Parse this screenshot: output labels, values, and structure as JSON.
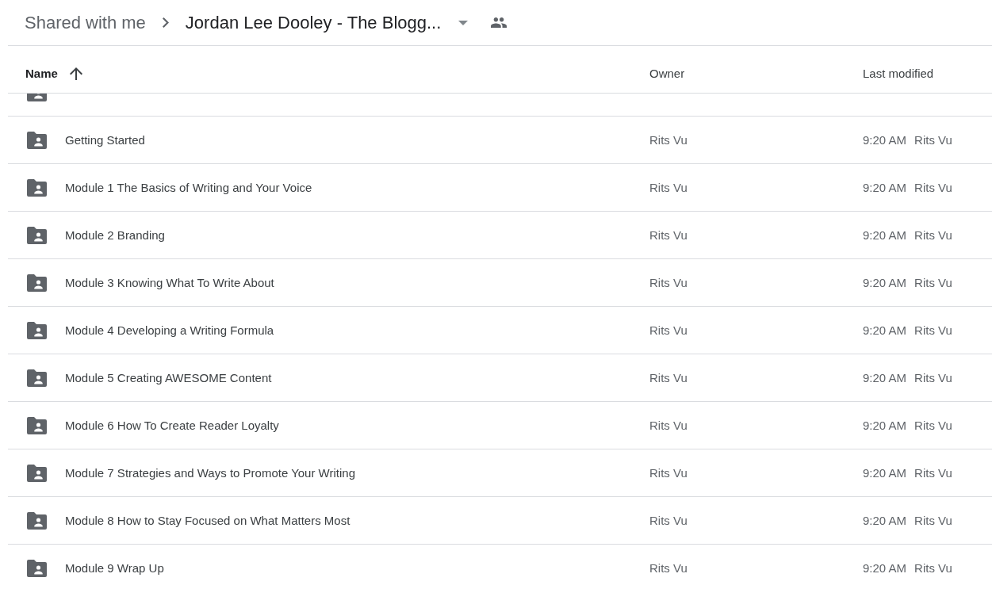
{
  "breadcrumb": {
    "parent": "Shared with me",
    "current": "Jordan Lee Dooley - The Blogg...",
    "shared": true
  },
  "columns": [
    {
      "label": "Name",
      "sorted": true,
      "ascending": true
    },
    {
      "label": "Owner",
      "sorted": false
    },
    {
      "label": "Last modified",
      "sorted": false
    }
  ],
  "rows": [
    {
      "name": "Getting Started",
      "owner": "Rits Vu",
      "modified": "9:20 AM",
      "modified_by": "Rits Vu"
    },
    {
      "name": "Module 1 The Basics of Writing and Your Voice",
      "owner": "Rits Vu",
      "modified": "9:20 AM",
      "modified_by": "Rits Vu"
    },
    {
      "name": "Module 2 Branding",
      "owner": "Rits Vu",
      "modified": "9:20 AM",
      "modified_by": "Rits Vu"
    },
    {
      "name": "Module 3 Knowing What To Write About",
      "owner": "Rits Vu",
      "modified": "9:20 AM",
      "modified_by": "Rits Vu"
    },
    {
      "name": "Module 4 Developing a Writing Formula",
      "owner": "Rits Vu",
      "modified": "9:20 AM",
      "modified_by": "Rits Vu"
    },
    {
      "name": "Module 5 Creating AWESOME Content",
      "owner": "Rits Vu",
      "modified": "9:20 AM",
      "modified_by": "Rits Vu"
    },
    {
      "name": "Module 6 How To Create Reader Loyalty",
      "owner": "Rits Vu",
      "modified": "9:20 AM",
      "modified_by": "Rits Vu"
    },
    {
      "name": "Module 7 Strategies and Ways to Promote Your Writing",
      "owner": "Rits Vu",
      "modified": "9:20 AM",
      "modified_by": "Rits Vu"
    },
    {
      "name": "Module 8 How to Stay Focused on What Matters Most",
      "owner": "Rits Vu",
      "modified": "9:20 AM",
      "modified_by": "Rits Vu"
    },
    {
      "name": "Module 9 Wrap Up",
      "owner": "Rits Vu",
      "modified": "9:20 AM",
      "modified_by": "Rits Vu"
    }
  ]
}
